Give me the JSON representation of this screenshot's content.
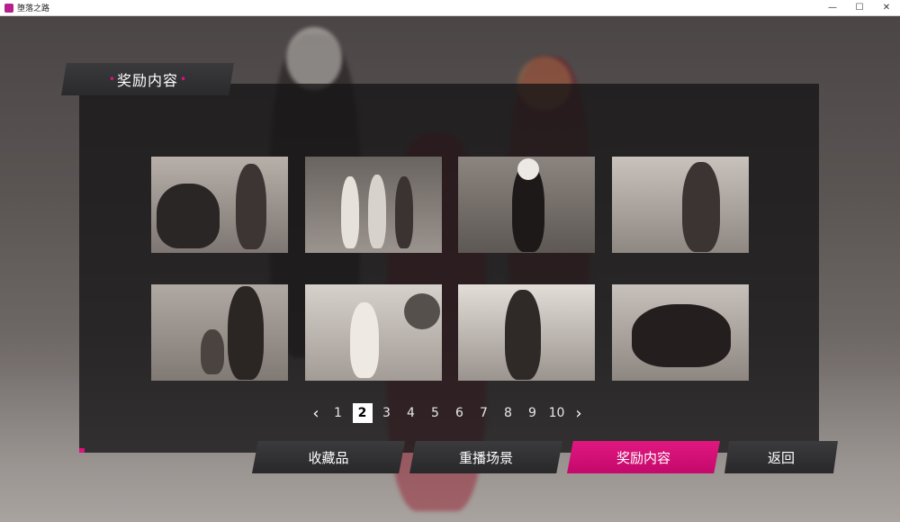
{
  "window": {
    "title": "堕落之路",
    "controls": {
      "minimize": "—",
      "maximize": "☐",
      "close": "✕"
    }
  },
  "panel": {
    "title": "奖励内容"
  },
  "thumbnails": [
    {
      "tone": "#8d8580"
    },
    {
      "tone": "#6e6864"
    },
    {
      "tone": "#5f5955"
    },
    {
      "tone": "#99908a"
    },
    {
      "tone": "#8a8480"
    },
    {
      "tone": "#a7a19d"
    },
    {
      "tone": "#7a736f"
    },
    {
      "tone": "#6f6965"
    }
  ],
  "pagination": {
    "prev_icon": "‹",
    "next_icon": "›",
    "pages": [
      "1",
      "2",
      "3",
      "4",
      "5",
      "6",
      "7",
      "8",
      "9",
      "10"
    ],
    "current": "2"
  },
  "buttons": {
    "collection": "收藏品",
    "replay": "重播场景",
    "rewards": "奖励内容",
    "back": "返回"
  },
  "colors": {
    "accent": "#e0107f",
    "panel": "#161516"
  }
}
